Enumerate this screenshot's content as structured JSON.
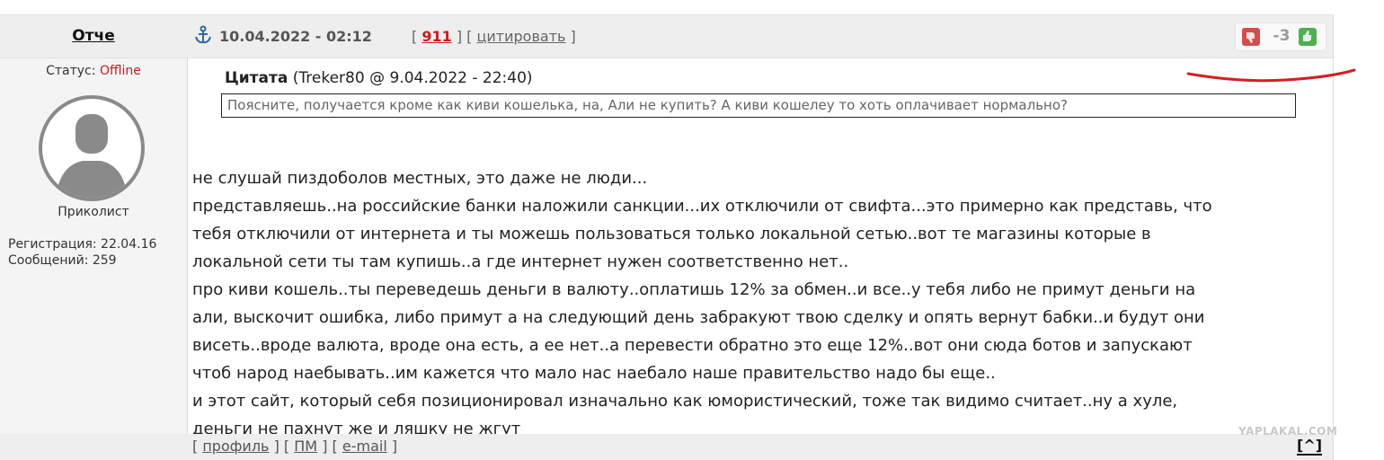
{
  "author": {
    "name": "Отче"
  },
  "post": {
    "date": "10.04.2022 - 02:12",
    "bracket_open": "[",
    "bracket_mid": "] [",
    "bracket_close": "]",
    "number": "911",
    "quote_link": "цитировать"
  },
  "rating": {
    "score": "-3",
    "down_icon": "thumb-down",
    "up_icon": "thumb-up"
  },
  "user": {
    "status_label": "Статус:",
    "status_value": "Offline",
    "title": "Приколист",
    "reg_label": "Регистрация: 22.04.16",
    "posts_label": "Сообщений: 259"
  },
  "quote": {
    "title": "Цитата",
    "source": "(Treker80 @ 9.04.2022 - 22:40)",
    "text": "Поясните, получается кроме как киви кошелька, на, Али не купить? А киви кошелеу то хоть оплачивает нормально?"
  },
  "body_lines": [
    "не слушай пиздоболов местных, это даже не люди...",
    "представляешь..на российские банки наложили санкции...их отключили от свифта...это примерно как представь, что",
    "тебя отключили от интернета и ты можешь пользоваться только локальной сетью..вот те магазины которые в",
    "локальной сети ты там купишь..а где интернет нужен соответственно нет..",
    "про киви кошель..ты переведешь деньги в валюту..оплатишь 12% за обмен..и все..у тебя либо не примут деньги на",
    "али, выскочит ошибка, либо примут а на следующий день забракуют твою сделку и опять вернут бабки..и будут они",
    "висеть..вроде валюта, вроде она есть, а ее нет..а перевести обратно это еще 12%..вот они сюда ботов и запускают",
    "чтоб народ наебывать..им кажется что мало нас наебало наше правительство надо бы еще..",
    "и этот сайт, который себя позиционировал изначально как юмористический, тоже так видимо считает..ну а хуле,",
    "деньги не пахнут же и ляшку не жгут"
  ],
  "footer": {
    "b1": "[",
    "profile": "профиль",
    "b2": "] [",
    "pm": "ПМ",
    "b3": "] [",
    "email": "e-mail",
    "b4": "]",
    "top": "[^]"
  },
  "watermark": "YAPLAKAL.COM",
  "colors": {
    "annotation": "#d42020",
    "thumb_down": "#d74b4b",
    "thumb_up": "#4fb04f",
    "post_number": "#cc1a1a"
  }
}
